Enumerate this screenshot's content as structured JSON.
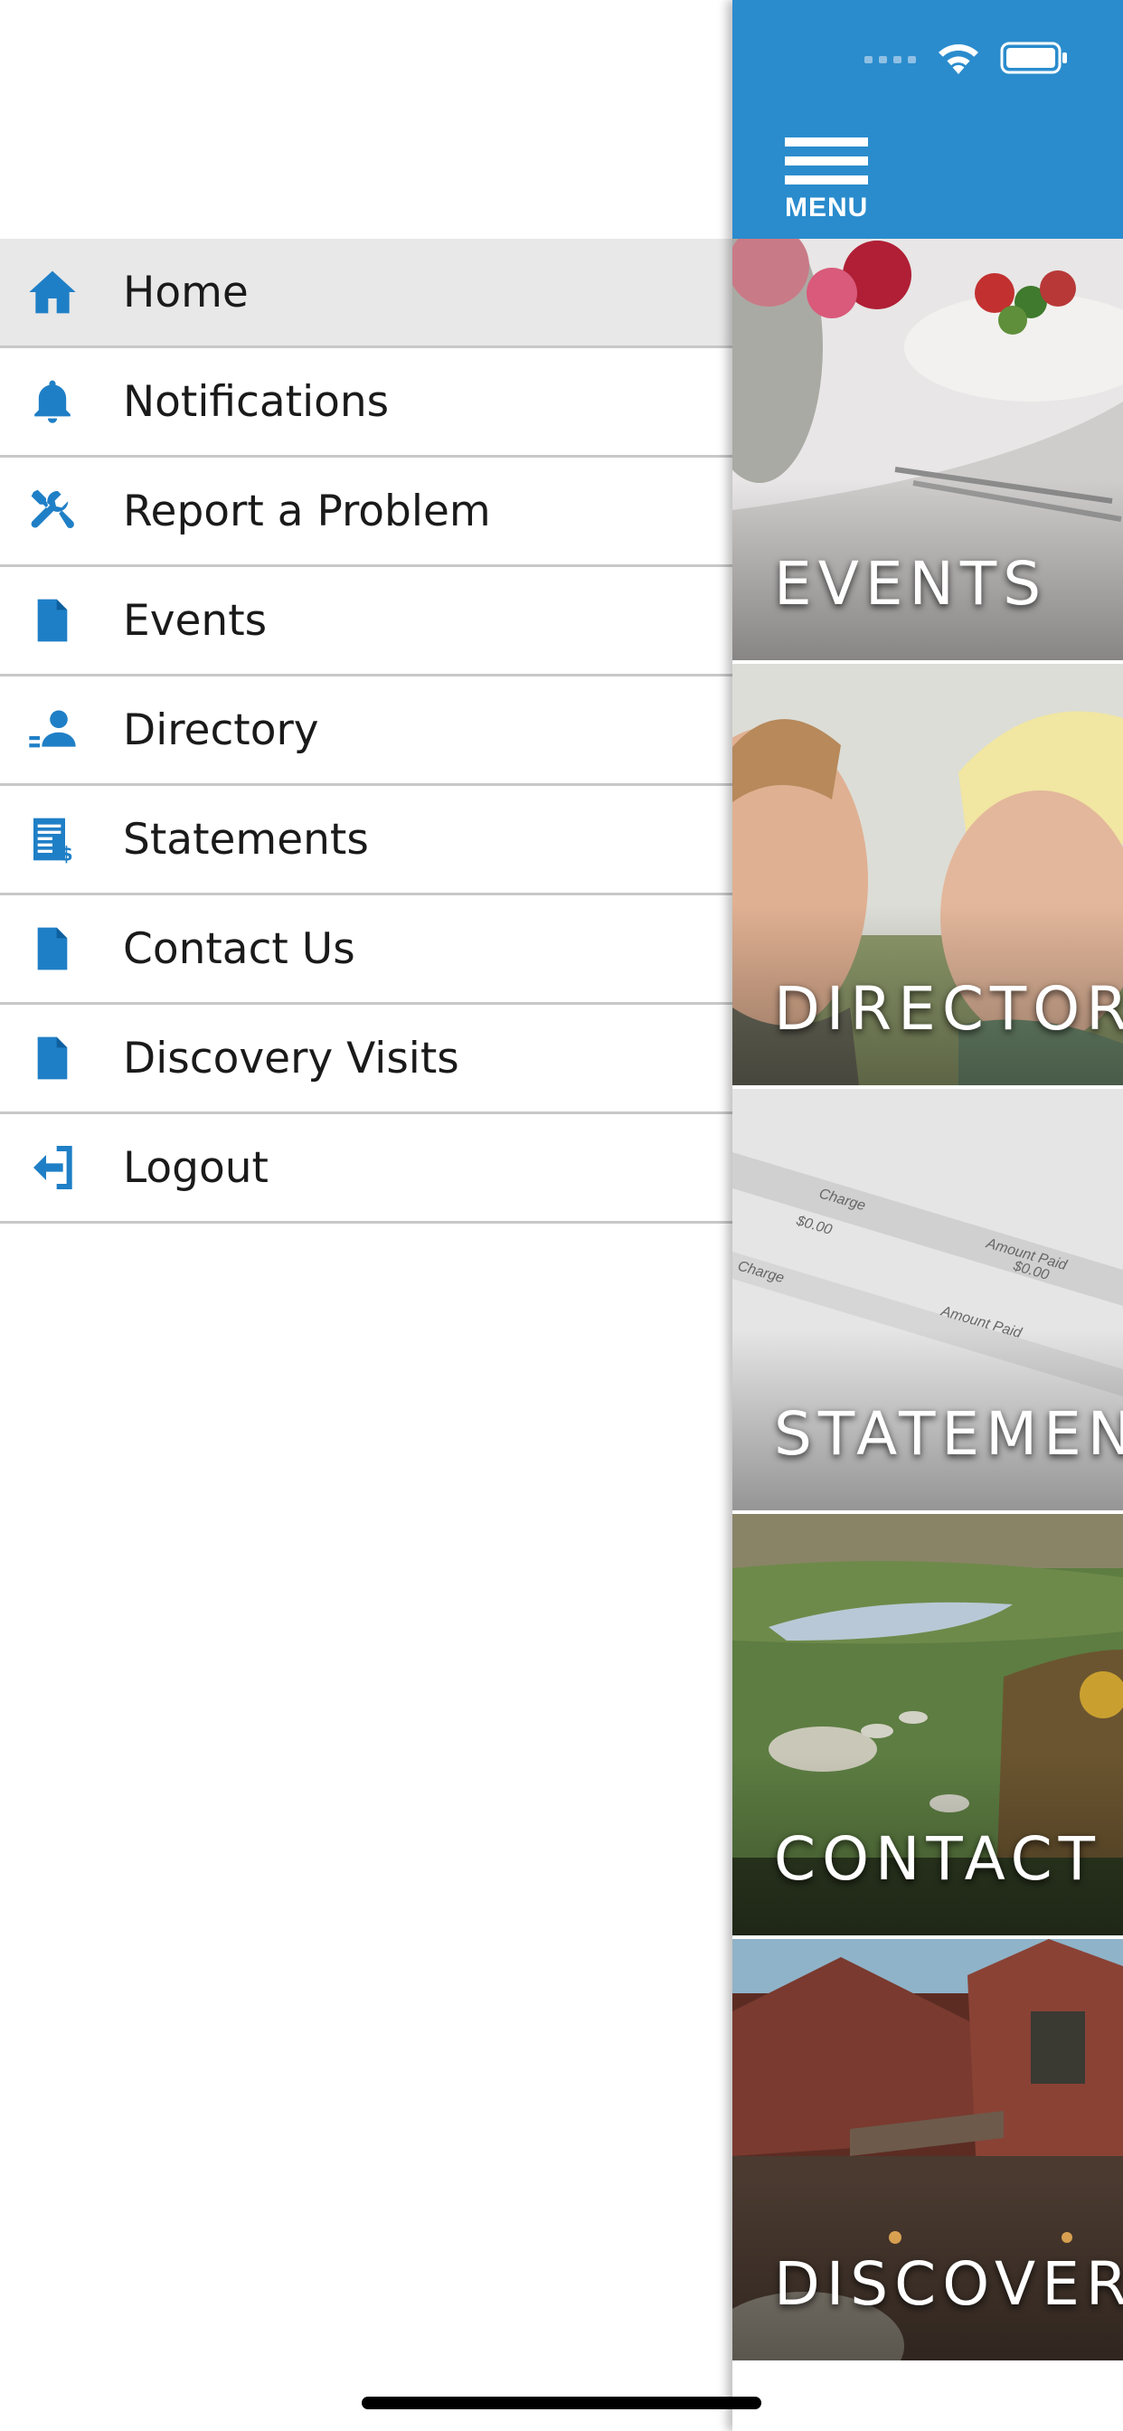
{
  "drawer": {
    "items": [
      {
        "label": "Home",
        "icon": "home-icon",
        "active": true
      },
      {
        "label": "Notifications",
        "icon": "bell-icon",
        "active": false
      },
      {
        "label": "Report a Problem",
        "icon": "tools-icon",
        "active": false
      },
      {
        "label": "Events",
        "icon": "document-icon",
        "active": false
      },
      {
        "label": "Directory",
        "icon": "person-icon",
        "active": false
      },
      {
        "label": "Statements",
        "icon": "statement-icon",
        "active": false
      },
      {
        "label": "Contact Us",
        "icon": "document-icon",
        "active": false
      },
      {
        "label": "Discovery Visits",
        "icon": "document-icon",
        "active": false
      },
      {
        "label": "Logout",
        "icon": "logout-icon",
        "active": false
      }
    ]
  },
  "header": {
    "menu_label": "MENU",
    "color": "#2a8ccd"
  },
  "tiles": [
    {
      "label": "EVENTS"
    },
    {
      "label": "DIRECTORY"
    },
    {
      "label": "STATEMENTS"
    },
    {
      "label": "CONTACT US"
    },
    {
      "label": "DISCOVERY VISITS"
    }
  ],
  "statement_image": {
    "charge_label": "Charge",
    "amount_paid_label": "Amount Paid",
    "amount": "$0.00"
  },
  "colors": {
    "accent": "#2a8ccd",
    "icon_blue": "#1f7fc6",
    "active_row": "#e8e8e8"
  }
}
